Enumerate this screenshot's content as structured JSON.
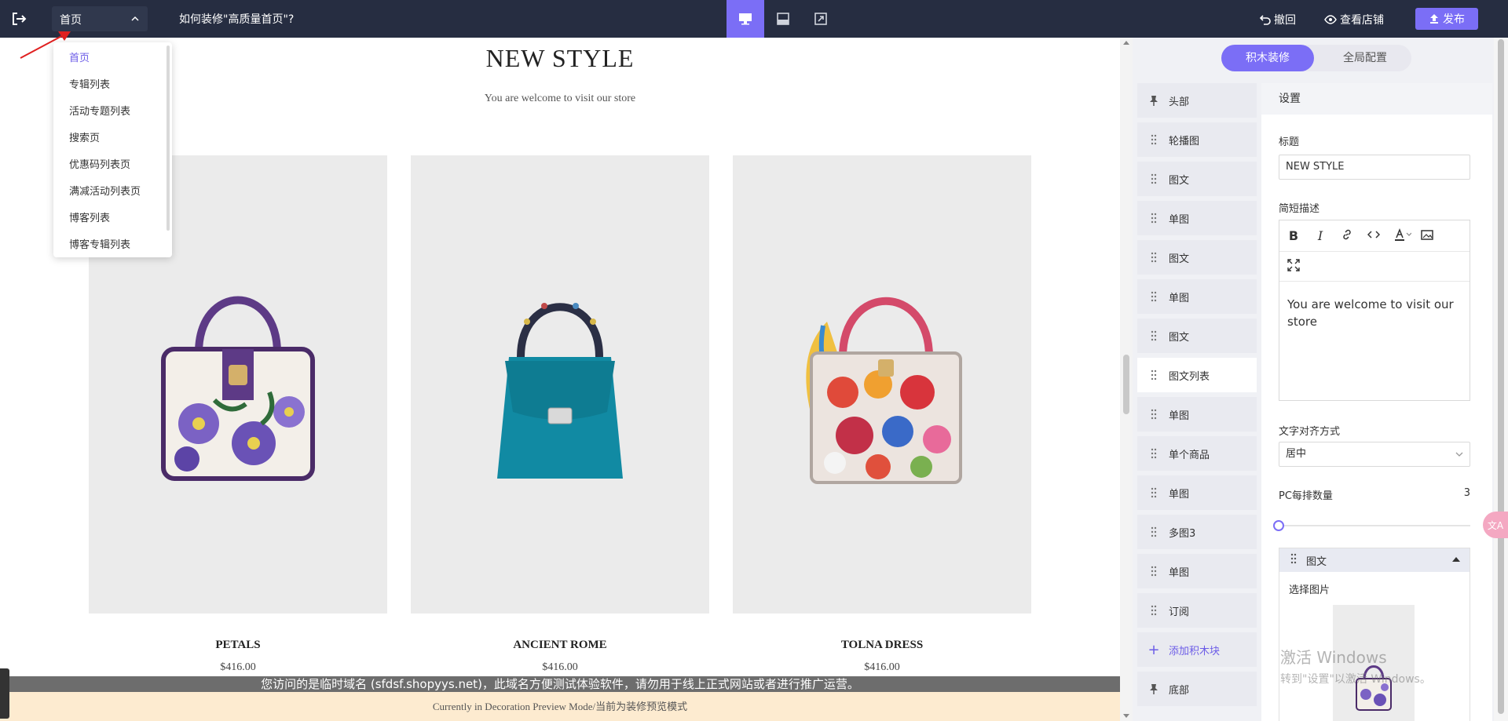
{
  "topbar": {
    "current_page": "首页",
    "help_text": "如何装修\"高质量首页\"?",
    "undo_label": "撤回",
    "view_store_label": "查看店铺",
    "publish_label": "发布"
  },
  "page_dropdown": {
    "items": [
      "首页",
      "专辑列表",
      "活动专题列表",
      "搜索页",
      "优惠码列表页",
      "满减活动列表页",
      "博客列表",
      "博客专辑列表"
    ],
    "active_index": 0
  },
  "preview": {
    "title": "NEW STYLE",
    "description": "You are welcome to visit our store",
    "products": [
      {
        "name": "PETALS",
        "price": "$416.00"
      },
      {
        "name": "ANCIENT ROME",
        "price": "$416.00"
      },
      {
        "name": "TOLNA DRESS",
        "price": "$416.00"
      }
    ],
    "temp_domain_notice": "您访问的是临时域名 (sfdsf.shopyys.net)，此域名方便测试体验软件，请勿用于线上正式网站或者进行推广运营。",
    "mode_notice": "Currently in Decoration Preview Mode/当前为装修预览模式"
  },
  "editor": {
    "tabs": [
      "积木装修",
      "全局配置"
    ],
    "active_tab": 0,
    "blocks": [
      {
        "label": "头部",
        "icon": "pin-icon"
      },
      {
        "label": "轮播图",
        "icon": "drag-handle-icon"
      },
      {
        "label": "图文",
        "icon": "drag-handle-icon"
      },
      {
        "label": "单图",
        "icon": "drag-handle-icon"
      },
      {
        "label": "图文",
        "icon": "drag-handle-icon"
      },
      {
        "label": "单图",
        "icon": "drag-handle-icon"
      },
      {
        "label": "图文",
        "icon": "drag-handle-icon"
      },
      {
        "label": "图文列表",
        "icon": "drag-handle-icon"
      },
      {
        "label": "单图",
        "icon": "drag-handle-icon"
      },
      {
        "label": "单个商品",
        "icon": "drag-handle-icon"
      },
      {
        "label": "单图",
        "icon": "drag-handle-icon"
      },
      {
        "label": "多图3",
        "icon": "drag-handle-icon"
      },
      {
        "label": "单图",
        "icon": "drag-handle-icon"
      },
      {
        "label": "订阅",
        "icon": "drag-handle-icon"
      }
    ],
    "active_block_index": 7,
    "add_block_label": "添加积木块",
    "footer_block_label": "底部",
    "settings": {
      "header": "设置",
      "title_label": "标题",
      "title_value": "NEW STYLE",
      "desc_label": "简短描述",
      "desc_value": "You are welcome to visit our store",
      "align_label": "文字对齐方式",
      "align_value": "居中",
      "per_row_label": "PC每排数量",
      "per_row_value": "3",
      "sub_block_title": "图文",
      "choose_image_label": "选择图片"
    }
  },
  "watermark": {
    "line1": "激活 Windows",
    "line2": "转到\"设置\"以激活 Windows。"
  },
  "colors": {
    "topbar_bg": "#262d41",
    "accent": "#7b6ef6"
  }
}
